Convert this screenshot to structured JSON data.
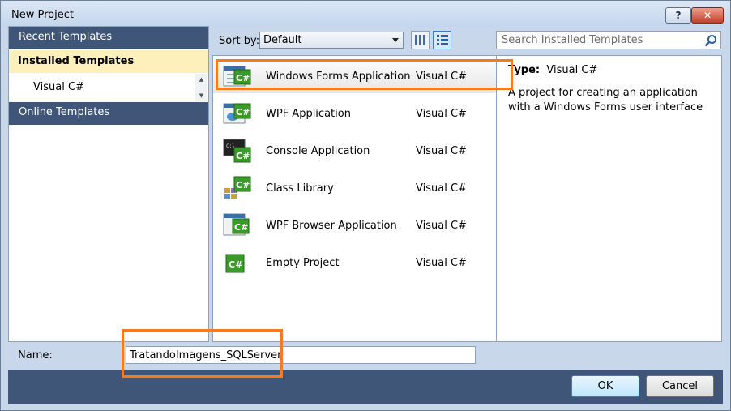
{
  "window": {
    "title": "New Project",
    "help_glyph": "?",
    "close_glyph": "✕"
  },
  "nav": {
    "recent": "Recent Templates",
    "installed": "Installed Templates",
    "sub_item": "Visual C#",
    "online": "Online Templates"
  },
  "toolbar": {
    "sort_label": "Sort by:",
    "sort_value": "Default",
    "search_placeholder": "Search Installed Templates"
  },
  "templates": [
    {
      "name": "Windows Forms Application",
      "lang": "Visual C#",
      "icon": "winforms-csharp-icon"
    },
    {
      "name": "WPF Application",
      "lang": "Visual C#",
      "icon": "wpf-csharp-icon"
    },
    {
      "name": "Console Application",
      "lang": "Visual C#",
      "icon": "console-csharp-icon"
    },
    {
      "name": "Class Library",
      "lang": "Visual C#",
      "icon": "classlib-csharp-icon"
    },
    {
      "name": "WPF Browser Application",
      "lang": "Visual C#",
      "icon": "wpf-browser-csharp-icon"
    },
    {
      "name": "Empty Project",
      "lang": "Visual C#",
      "icon": "empty-csharp-icon"
    }
  ],
  "details": {
    "type_label": "Type:",
    "type_value": "Visual C#",
    "description": "A project for creating an application with a Windows Forms user interface"
  },
  "name_field": {
    "label": "Name:",
    "value": "TratandoImagens_SQLServer"
  },
  "buttons": {
    "ok": "OK",
    "cancel": "Cancel"
  },
  "colors": {
    "highlight": "#f47b20",
    "nav_dark": "#3f5678",
    "csharp_green": "#3a9a2a"
  }
}
